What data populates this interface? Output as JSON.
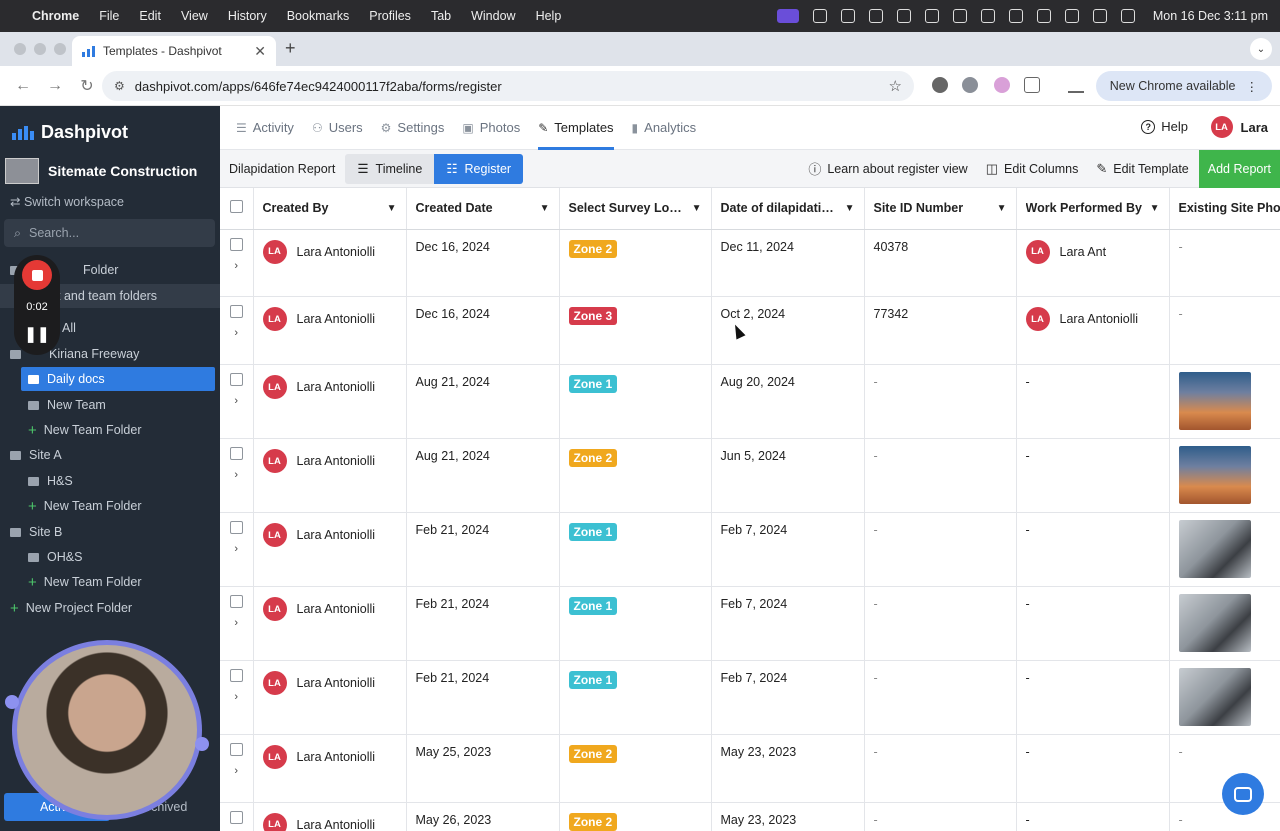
{
  "menubar": {
    "app": "Chrome",
    "items": [
      "File",
      "Edit",
      "View",
      "History",
      "Bookmarks",
      "Profiles",
      "Tab",
      "Window",
      "Help"
    ],
    "clock": "Mon 16 Dec  3:11 pm"
  },
  "browser": {
    "tab_title": "Templates - Dashpivot",
    "url": "dashpivot.com/apps/646fe74ec9424000117f2aba/forms/register",
    "new_chrome": "New Chrome available"
  },
  "sidebar": {
    "brand": "Dashpivot",
    "workspace": "Sitemate Construction",
    "switch_label": "Switch workspace",
    "search_placeholder": "Search...",
    "items": [
      {
        "label": "Folder",
        "kind": "folder"
      },
      {
        "label": "t and team folders",
        "kind": "highlight"
      },
      {
        "label": "All",
        "kind": "plain"
      },
      {
        "label": "Kiriana Freeway",
        "kind": "folder"
      },
      {
        "label": "Daily docs",
        "kind": "selected"
      },
      {
        "label": "New Team",
        "kind": "folder"
      },
      {
        "label": "New Team Folder",
        "kind": "add"
      },
      {
        "label": "Site A",
        "kind": "folder"
      },
      {
        "label": "H&S",
        "kind": "folder"
      },
      {
        "label": "New Team Folder",
        "kind": "add"
      },
      {
        "label": "Site B",
        "kind": "folder"
      },
      {
        "label": "OH&S",
        "kind": "folder"
      },
      {
        "label": "New Team Folder",
        "kind": "add"
      },
      {
        "label": "New Project Folder",
        "kind": "add"
      }
    ],
    "tab_active": "Active",
    "tab_archived": "Archived"
  },
  "recorder": {
    "time": "0:02"
  },
  "topnav": {
    "items": [
      {
        "label": "Activity",
        "icon": "list-icon"
      },
      {
        "label": "Users",
        "icon": "users-icon"
      },
      {
        "label": "Settings",
        "icon": "gear-icon"
      },
      {
        "label": "Photos",
        "icon": "image-icon"
      },
      {
        "label": "Templates",
        "icon": "edit-icon"
      },
      {
        "label": "Analytics",
        "icon": "bar-chart-icon"
      }
    ],
    "active": "Templates",
    "help": "Help",
    "user_initials": "LA",
    "user_name": "Lara"
  },
  "toolbar": {
    "title": "Dilapidation Report",
    "timeline": "Timeline",
    "register": "Register",
    "learn": "Learn about register view",
    "edit_columns": "Edit Columns",
    "edit_template": "Edit Template",
    "add_report": "Add Report"
  },
  "table": {
    "columns": [
      "Created By",
      "Created Date",
      "Select Survey Loca...",
      "Date of dilapidatio...",
      "Site ID Number",
      "Work Performed By",
      "Existing Site Photos"
    ],
    "zone_colors": {
      "Zone 1": "#3cc0d2",
      "Zone 2": "#f0a81e",
      "Zone 3": "#d63b4b"
    },
    "rows": [
      {
        "initials": "LA",
        "created_by": "Lara Antoniolli",
        "created_date": "Dec 16, 2024",
        "zone": "Zone 2",
        "dilap_date": "Dec 11, 2024",
        "site_id": "40378",
        "work_by": "Lara Ant",
        "work_initials": "LA",
        "photo": "-"
      },
      {
        "initials": "LA",
        "created_by": "Lara Antoniolli",
        "created_date": "Dec 16, 2024",
        "zone": "Zone 3",
        "dilap_date": "Oct 2, 2024",
        "site_id": "77342",
        "work_by": "Lara Antoniolli",
        "work_initials": "LA",
        "photo": "-"
      },
      {
        "initials": "LA",
        "created_by": "Lara Antoniolli",
        "created_date": "Aug 21, 2024",
        "zone": "Zone 1",
        "dilap_date": "Aug 20, 2024",
        "site_id": "-",
        "work_by": "-",
        "work_initials": "",
        "photo": "crane"
      },
      {
        "initials": "LA",
        "created_by": "Lara Antoniolli",
        "created_date": "Aug 21, 2024",
        "zone": "Zone 2",
        "dilap_date": "Jun 5, 2024",
        "site_id": "-",
        "work_by": "-",
        "work_initials": "",
        "photo": "crane"
      },
      {
        "initials": "LA",
        "created_by": "Lara Antoniolli",
        "created_date": "Feb 21, 2024",
        "zone": "Zone 1",
        "dilap_date": "Feb 7, 2024",
        "site_id": "-",
        "work_by": "-",
        "work_initials": "",
        "photo": "bag"
      },
      {
        "initials": "LA",
        "created_by": "Lara Antoniolli",
        "created_date": "Feb 21, 2024",
        "zone": "Zone 1",
        "dilap_date": "Feb 7, 2024",
        "site_id": "-",
        "work_by": "-",
        "work_initials": "",
        "photo": "bag"
      },
      {
        "initials": "LA",
        "created_by": "Lara Antoniolli",
        "created_date": "Feb 21, 2024",
        "zone": "Zone 1",
        "dilap_date": "Feb 7, 2024",
        "site_id": "-",
        "work_by": "-",
        "work_initials": "",
        "photo": "bag"
      },
      {
        "initials": "LA",
        "created_by": "Lara Antoniolli",
        "created_date": "May 25, 2023",
        "zone": "Zone 2",
        "dilap_date": "May 23, 2023",
        "site_id": "-",
        "work_by": "-",
        "work_initials": "",
        "photo": "-"
      },
      {
        "initials": "LA",
        "created_by": "Lara Antoniolli",
        "created_date": "May 26, 2023",
        "zone": "Zone 2",
        "dilap_date": "May 23, 2023",
        "site_id": "-",
        "work_by": "-",
        "work_initials": "",
        "photo": "-"
      }
    ]
  }
}
